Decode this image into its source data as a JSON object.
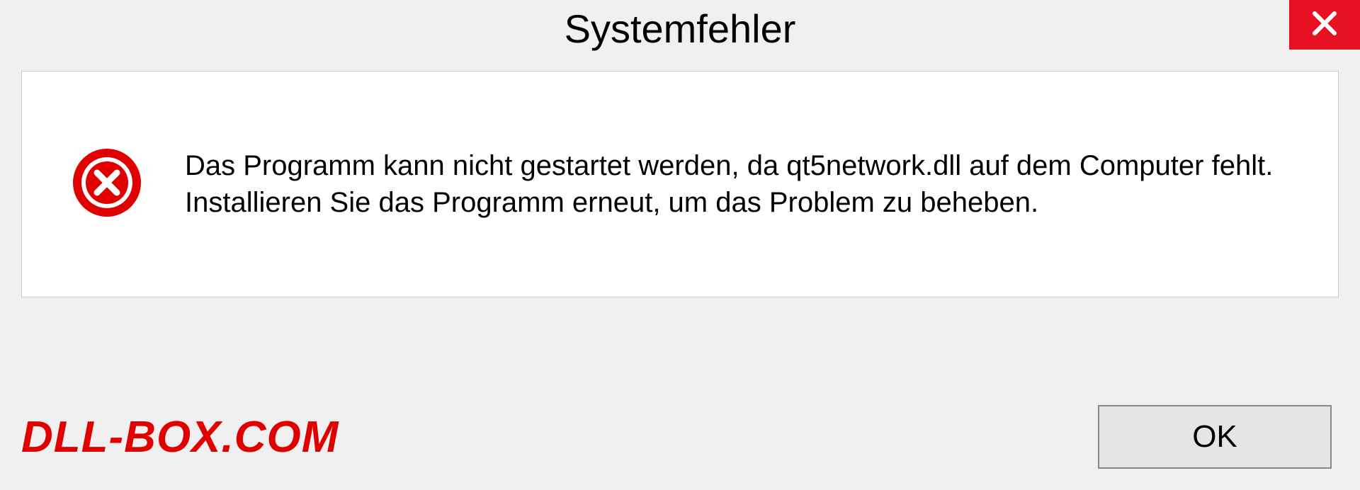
{
  "dialog": {
    "title": "Systemfehler",
    "message": "Das Programm kann nicht gestartet werden, da qt5network.dll auf dem Computer fehlt. Installieren Sie das Programm erneut, um das Problem zu beheben.",
    "ok_label": "OK"
  },
  "watermark": "DLL-BOX.COM",
  "icons": {
    "close": "close-icon",
    "error": "error-icon"
  },
  "colors": {
    "close_bg": "#e81123",
    "error_red": "#e00000",
    "dialog_bg": "#f0f0f0",
    "content_bg": "#ffffff"
  }
}
